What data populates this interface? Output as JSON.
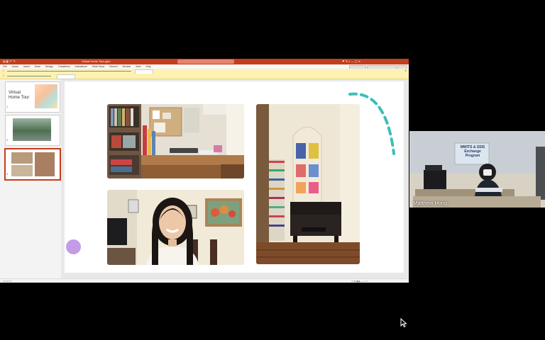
{
  "powerpoint": {
    "title": "Virtual Home Tour.pptx",
    "ribbon_tabs": [
      "File",
      "Home",
      "Insert",
      "Draw",
      "Design",
      "Transitions",
      "Animations",
      "Slide Show",
      "Record",
      "Review",
      "View",
      "Help"
    ]
  },
  "slides": [
    {
      "number": "1",
      "title_line1": "Virtual",
      "title_line2": "Home Tour"
    },
    {
      "number": "2"
    },
    {
      "number": "3"
    }
  ],
  "participant": {
    "name": "Matthew Hong",
    "banner_line1": "MWITS & SSIS",
    "banner_line2": "Exchange Program"
  },
  "colors": {
    "ppt_accent": "#c43e1c",
    "teal_arc": "#3bbfb7",
    "purple_dot": "#c39be8"
  }
}
